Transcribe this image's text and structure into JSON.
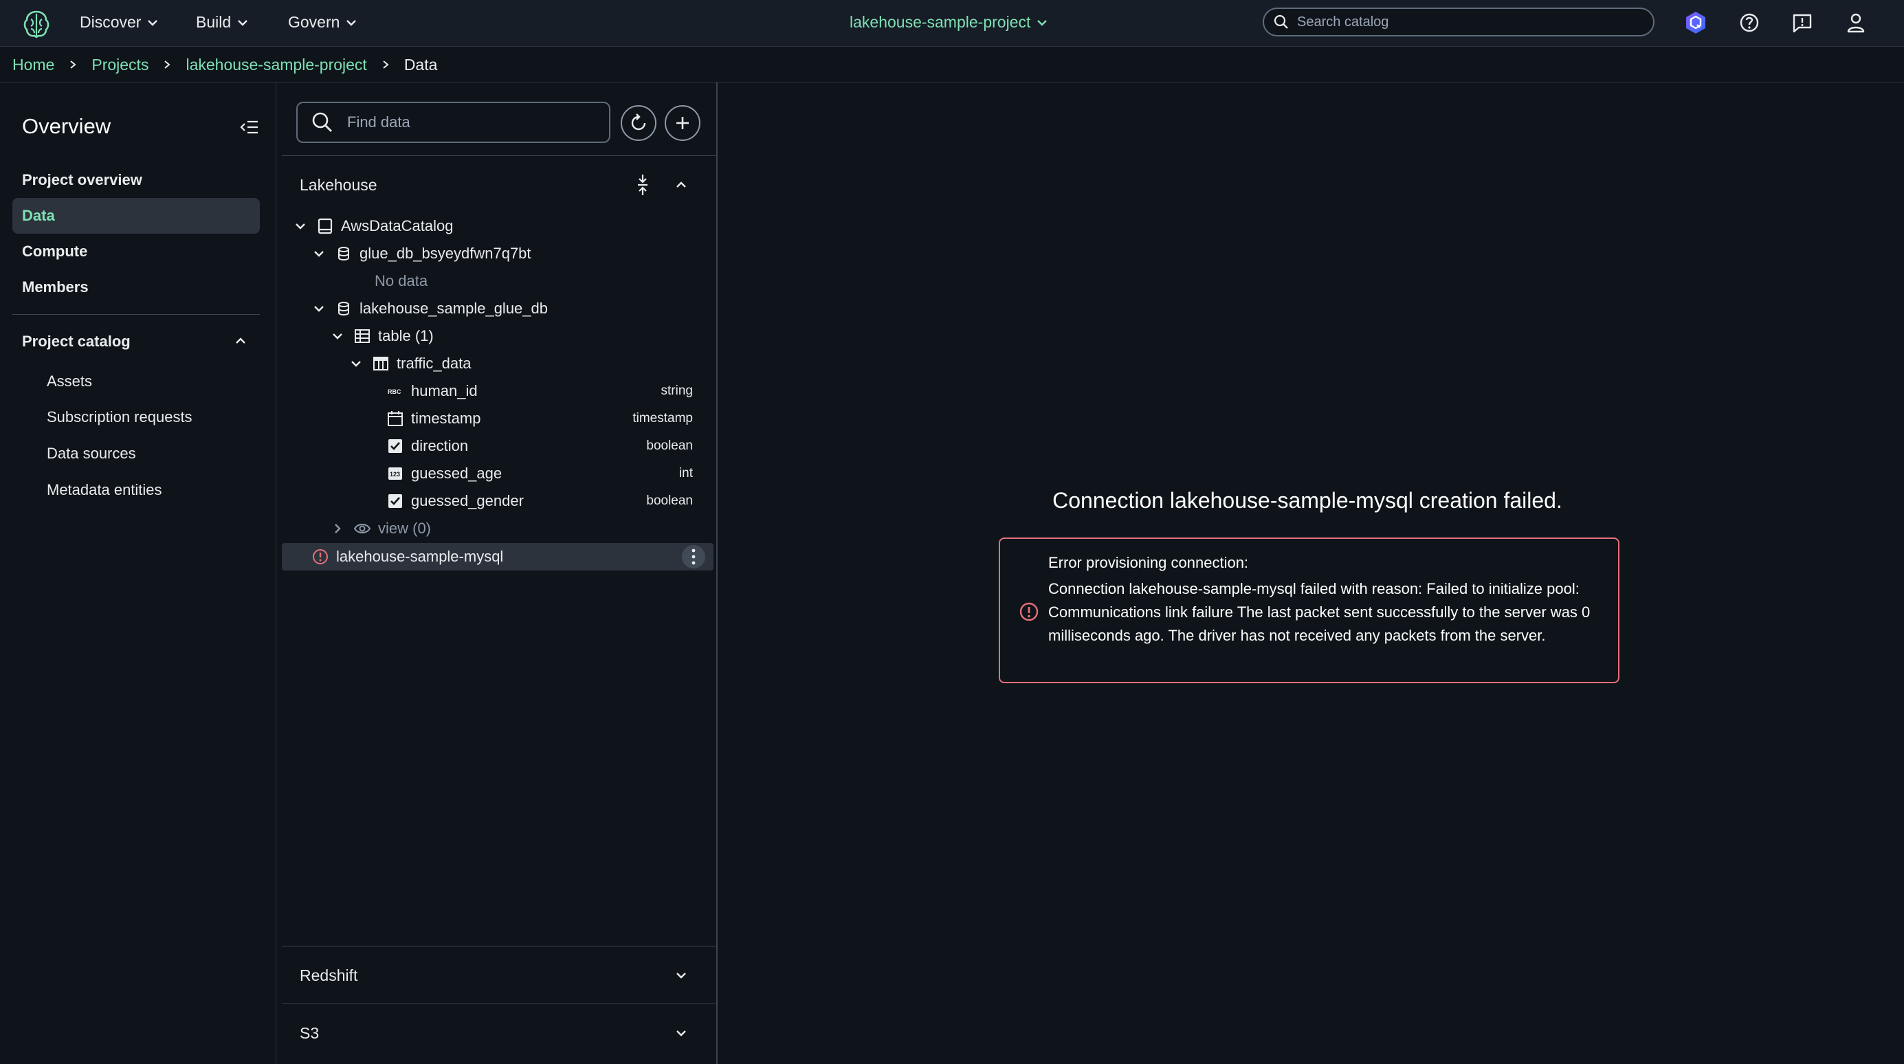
{
  "topnav": {
    "menus": [
      {
        "label": "Discover"
      },
      {
        "label": "Build"
      },
      {
        "label": "Govern"
      }
    ],
    "project": "lakehouse-sample-project",
    "search_placeholder": "Search catalog"
  },
  "breadcrumb": {
    "home": "Home",
    "projects": "Projects",
    "project": "lakehouse-sample-project",
    "current": "Data"
  },
  "sidebar": {
    "title": "Overview",
    "items": [
      {
        "label": "Project overview",
        "active": false
      },
      {
        "label": "Data",
        "active": true
      },
      {
        "label": "Compute",
        "active": false
      },
      {
        "label": "Members",
        "active": false
      }
    ],
    "catalog_section": "Project catalog",
    "catalog_items": [
      {
        "label": "Assets"
      },
      {
        "label": "Subscription requests"
      },
      {
        "label": "Data sources"
      },
      {
        "label": "Metadata entities"
      }
    ]
  },
  "datapanel": {
    "find_placeholder": "Find data",
    "lakehouse": {
      "title": "Lakehouse",
      "catalog": "AwsDataCatalog",
      "db1": {
        "name": "glue_db_bsyeydfwn7q7bt",
        "empty": "No data"
      },
      "db2": {
        "name": "lakehouse_sample_glue_db"
      },
      "tables_group": "table (1)",
      "table": "traffic_data",
      "columns": [
        {
          "name": "human_id",
          "type": "string",
          "icon": "abc-text-icon"
        },
        {
          "name": "timestamp",
          "type": "timestamp",
          "icon": "calendar-icon"
        },
        {
          "name": "direction",
          "type": "boolean",
          "icon": "checkbox-icon"
        },
        {
          "name": "guessed_age",
          "type": "int",
          "icon": "number-icon"
        },
        {
          "name": "guessed_gender",
          "type": "boolean",
          "icon": "checkbox-icon"
        }
      ],
      "views_group": "view (0)",
      "failed_connection": "lakehouse-sample-mysql"
    },
    "redshift": "Redshift",
    "s3": "S3"
  },
  "main": {
    "title": "Connection lakehouse-sample-mysql creation failed.",
    "error_heading": "Error provisioning connection:",
    "error_message": "Connection lakehouse-sample-mysql failed with reason: Failed to initialize pool: Communications link failure The last packet sent successfully to the server was 0 milliseconds ago. The driver has not received any packets from the server."
  },
  "colors": {
    "background": "#0f141a",
    "accent_green": "#7fe0b4",
    "error_red": "#e4707b",
    "selected_bg": "#2c333d"
  }
}
